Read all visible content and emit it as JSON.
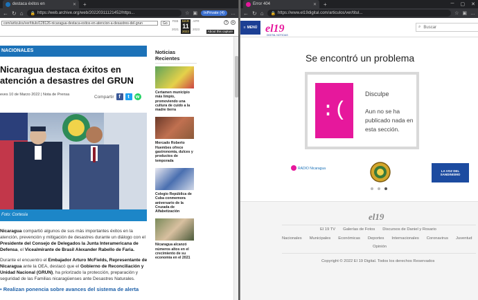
{
  "left": {
    "tab_title": "destaca éxitos en",
    "url": "https://web.archive.org/web/20220311121452/https...",
    "inprivate": "InPrivate (4)",
    "wayback": {
      "url_field": "com/articulos/ver/titulo/128126-nicaragua-destaca-exitos-en-atencion-a-desastres-del-grun",
      "go": "Go",
      "months": [
        "FEB",
        "MAR",
        "APR"
      ],
      "current_day": "11",
      "years": [
        "2021",
        "2022",
        "2023"
      ],
      "about": "About this capture"
    },
    "category": "NACIONALES",
    "title": "Nicaragua destaca éxitos en atención a desastres del GRUN",
    "date": "eves 10 de Marzo 2022 | Nota de Prensa",
    "share_label": "Compartir",
    "caption": "Foto: Cortesía",
    "paragraphs": [
      {
        "b1": "Nicaragua",
        "t1": " compartió algunos de sus más importantes éxitos en la atención, prevención y mitigación de desastres durante un diálogo con el ",
        "b2": "Presidente del Consejo de Delegados la Junta Interamericana de Defensa",
        "t2": ", el ",
        "b3": "Vicealmirante de Brasil Alexander Rabello de Faria."
      },
      {
        "t1": "Durante el encuentro el ",
        "b1": "Embajador Arturo McFields, Representante de Nicaragua",
        "t2": " ante la OEA, destacó que el ",
        "b2": "Gobierno de Reconciliación y Unidad Nacional (GRUN)",
        "t3": ", ha priorizado la protección, preparación y seguridad de las Familias nicaragüenses ante Desastres Naturales."
      }
    ],
    "bullet": "Realizan ponencia sobre avances del sistema de alerta",
    "sidebar_title": "Noticias Recientes",
    "news": [
      "Certamen municipio más limpio, promoviendo una cultura de cuido a la madre tierra",
      "Mercado Roberto Huembes ofrece gastronomía, dulces y productos de temporada",
      "Colegio República de Cuba conmemora aniversario de la Cruzada de Alfabetización",
      "Nicaragua alcanzó números altos en el crecimiento de su economía en el 2021"
    ]
  },
  "right": {
    "tab_title": "Error 404",
    "url": "https://www.el19digital.com/articulos/ver/titul...",
    "menu_label": "MENÚ",
    "logo_text": "el19",
    "logo_sub": "DIGITAL NOTICIAS",
    "search_placeholder": "Buscar",
    "error_title": "Se encontró un problema",
    "sad_face": ":(",
    "error_head": "Disculpe",
    "error_msg": "Aun no se ha publicado nada en esta sección.",
    "partners": [
      "RADIO Nicaragua",
      "LA VOZ DEL SANDINISMO"
    ],
    "footer_logo": "el19",
    "footer_links_1": [
      "El 19 TV",
      "Galerías de Fotos",
      "Discursos de Daniel y Rosario"
    ],
    "footer_links_2": [
      "Nacionales",
      "Municipales",
      "Económicas",
      "Deportes",
      "Internacionales",
      "Coronavirus",
      "Juventud"
    ],
    "footer_links_3": "Opinión",
    "copyright": "Copyright © 2022 El 19 Digital. Todos los derechos Reservados"
  },
  "colors": {
    "accent_blue": "#1c72b8",
    "brand_magenta": "#e6189c",
    "menu_blue": "#1c3f94"
  }
}
